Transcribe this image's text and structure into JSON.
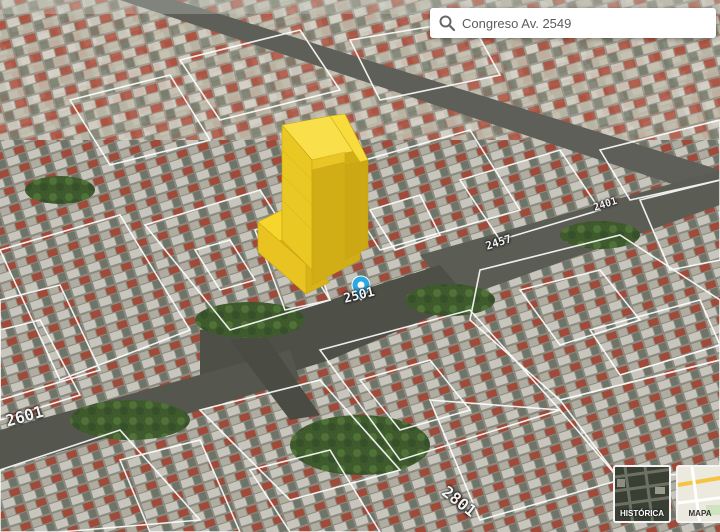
{
  "search": {
    "value": "Congreso Av. 2549",
    "icon": "search-icon"
  },
  "lot_labels": [
    "2601",
    "2501",
    "2457",
    "2401",
    "2801"
  ],
  "layers": {
    "historica": "HISTÓRICA",
    "mapa": "MAPA"
  },
  "colors": {
    "building_massing": "#f2cc1e",
    "pin": "#2aa8e0",
    "lot_outline": "#ffffff"
  }
}
